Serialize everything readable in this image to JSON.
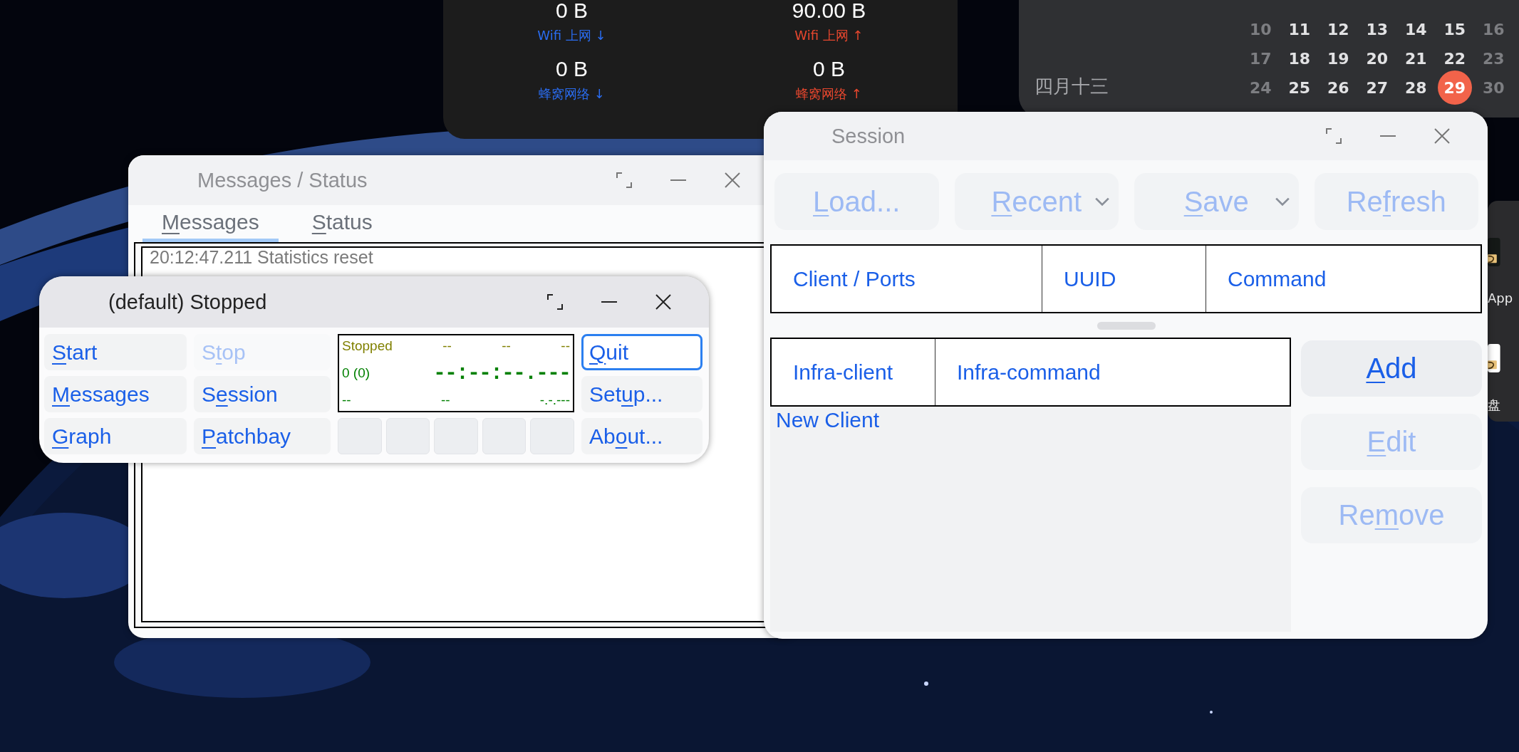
{
  "network_widget": {
    "cells": [
      {
        "value": "0 B",
        "label": "Wifi 上网 ↓",
        "color": "#2a6cf0"
      },
      {
        "value": "90.00 B",
        "label": "Wifi 上网 ↑",
        "color": "#e8472e"
      },
      {
        "value": "0 B",
        "label": "蜂窝网络 ↓",
        "color": "#2a6cf0"
      },
      {
        "value": "0 B",
        "label": "蜂窝网络 ↑",
        "color": "#e8472e"
      }
    ]
  },
  "calendar": {
    "lunar_date": "四月十三",
    "weeks": [
      [
        {
          "day": "10",
          "weekend": true,
          "today": false
        },
        {
          "day": "11",
          "weekend": false,
          "today": false
        },
        {
          "day": "12",
          "weekend": false,
          "today": false
        },
        {
          "day": "13",
          "weekend": false,
          "today": false
        },
        {
          "day": "14",
          "weekend": false,
          "today": false
        },
        {
          "day": "15",
          "weekend": false,
          "today": false
        },
        {
          "day": "16",
          "weekend": true,
          "today": false
        }
      ],
      [
        {
          "day": "17",
          "weekend": true,
          "today": false
        },
        {
          "day": "18",
          "weekend": false,
          "today": false
        },
        {
          "day": "19",
          "weekend": false,
          "today": false
        },
        {
          "day": "20",
          "weekend": false,
          "today": false
        },
        {
          "day": "21",
          "weekend": false,
          "today": false
        },
        {
          "day": "22",
          "weekend": false,
          "today": false
        },
        {
          "day": "23",
          "weekend": true,
          "today": false
        }
      ],
      [
        {
          "day": "24",
          "weekend": true,
          "today": false
        },
        {
          "day": "25",
          "weekend": false,
          "today": false
        },
        {
          "day": "26",
          "weekend": false,
          "today": false
        },
        {
          "day": "27",
          "weekend": false,
          "today": false
        },
        {
          "day": "28",
          "weekend": false,
          "today": false
        },
        {
          "day": "29",
          "weekend": false,
          "today": true
        },
        {
          "day": "30",
          "weekend": true,
          "today": false
        }
      ]
    ]
  },
  "dock": {
    "items": [
      {
        "label": "App"
      },
      {
        "label": "盘"
      }
    ]
  },
  "messages_window": {
    "title": "Messages / Status",
    "tabs": [
      {
        "key": "M",
        "post": "essages",
        "selected": true
      },
      {
        "key": "S",
        "post": "tatus",
        "selected": false
      }
    ],
    "log": [
      "20:12:47.211 Statistics reset"
    ]
  },
  "main_window": {
    "title": "(default) Stopped",
    "left_buttons": [
      {
        "key": "S",
        "post": "tart",
        "disabled": false
      },
      {
        "pre": "S",
        "key": "t",
        "post": "op",
        "disabled": true
      },
      {
        "key": "M",
        "post": "essages",
        "disabled": false
      },
      {
        "pre": "S",
        "key": "e",
        "post": "ssion",
        "disabled": false
      },
      {
        "key": "G",
        "post": "raph",
        "disabled": false
      },
      {
        "key": "P",
        "post": "atchbay",
        "disabled": false
      }
    ],
    "display": {
      "status": "Stopped",
      "top_fields": [
        "--",
        "--",
        "--"
      ],
      "count": "0 (0)",
      "time": "--:--:--.---",
      "bottom_fields": [
        "--",
        "--",
        "-.-.---"
      ]
    },
    "right_buttons": [
      {
        "key": "Q",
        "post": "uit",
        "focused": true
      },
      {
        "pre": "Set",
        "key": "u",
        "post": "p...",
        "focused": false
      },
      {
        "pre": "Ab",
        "key": "o",
        "post": "ut...",
        "focused": false
      }
    ]
  },
  "session_window": {
    "title": "Session",
    "toolbar": [
      {
        "key": "L",
        "post": "oad...",
        "disabled": true,
        "dropdown": false
      },
      {
        "key": "R",
        "post": "ecent",
        "disabled": true,
        "dropdown": true
      },
      {
        "key": "S",
        "post": "ave",
        "disabled": true,
        "dropdown": true
      },
      {
        "pre": "Re",
        "key": "f",
        "post": "resh",
        "disabled": true,
        "dropdown": false
      }
    ],
    "clients_table": {
      "columns": [
        "Client / Ports",
        "UUID",
        "Command"
      ]
    },
    "infra_table": {
      "columns": [
        "Infra-client",
        "Infra-command"
      ],
      "rows": [
        "New Client"
      ]
    },
    "side_buttons": [
      {
        "key": "A",
        "post": "dd",
        "disabled": false
      },
      {
        "key": "E",
        "post": "dit",
        "disabled": true
      },
      {
        "pre": "Re",
        "key": "m",
        "post": "ove",
        "disabled": true
      }
    ]
  }
}
